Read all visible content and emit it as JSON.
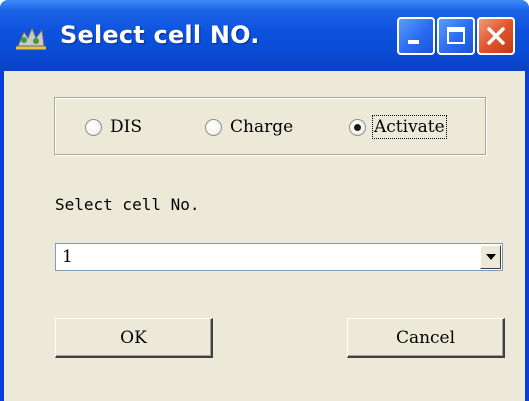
{
  "window": {
    "title": "Select cell NO."
  },
  "mode_group": {
    "options": [
      {
        "label": "DIS",
        "selected": false
      },
      {
        "label": "Charge",
        "selected": false
      },
      {
        "label": "Activate",
        "selected": true
      }
    ]
  },
  "cell_select": {
    "label": "Select cell No.",
    "value": "1"
  },
  "buttons": {
    "ok_label": "OK",
    "cancel_label": "Cancel"
  },
  "icons": {
    "app": "app-icon",
    "minimize": "minimize-icon",
    "maximize": "maximize-icon",
    "close": "close-icon",
    "dropdown": "chevron-down-icon"
  },
  "colors": {
    "titlebar": "#0a4bd3",
    "client_background": "#ece9d8",
    "close_button": "#e1552d"
  }
}
